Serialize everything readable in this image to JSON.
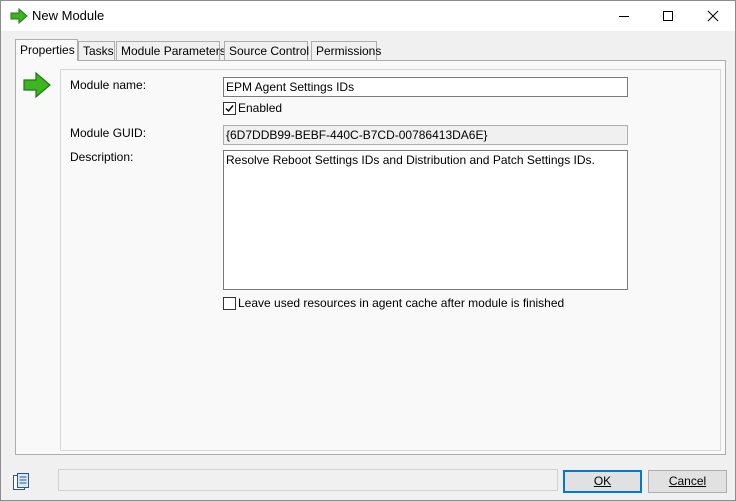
{
  "window": {
    "title": "New Module",
    "controls": {
      "minimize_icon": "minimize-icon",
      "maximize_icon": "maximize-icon",
      "close_icon": "close-icon"
    }
  },
  "tabs": [
    {
      "label": "Properties",
      "active": true
    },
    {
      "label": "Tasks",
      "active": false
    },
    {
      "label": "Module Parameters",
      "active": false
    },
    {
      "label": "Source Control",
      "active": false
    },
    {
      "label": "Permissions",
      "active": false
    }
  ],
  "form": {
    "module_name_label": "Module name:",
    "module_name_value": "EPM Agent Settings IDs",
    "enabled_label": "Enabled",
    "enabled_checked": true,
    "guid_label": "Module GUID:",
    "guid_value": "{6D7DDB99-BEBF-440C-B7CD-00786413DA6E}",
    "description_label": "Description:",
    "description_value": "Resolve Reboot Settings IDs and Distribution and Patch Settings IDs.",
    "leave_resources_label": "Leave used resources in agent cache after module is finished",
    "leave_resources_checked": false
  },
  "buttons": {
    "ok_label": "OK",
    "cancel_label": "Cancel"
  },
  "colors": {
    "accent": "#0078d7",
    "arrow_green": "#3cb521"
  }
}
